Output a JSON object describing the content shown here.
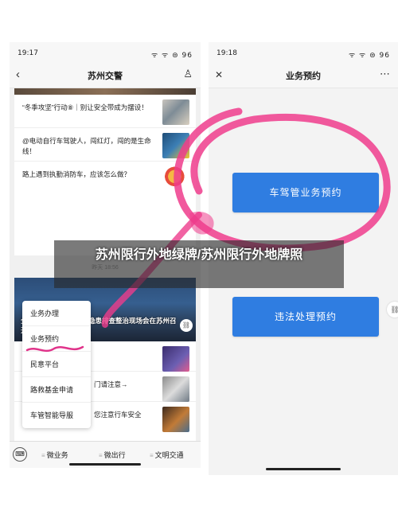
{
  "left_phone": {
    "status": {
      "time": "19:17",
      "icons": "ᯤ ᯤ ⊜ 96"
    },
    "navbar": {
      "title": "苏州交警",
      "back": "‹",
      "profile": "♙"
    },
    "news_top": [
      {
        "text": "“冬季攻坚”行动⑧｜别让安全带成为摆设！"
      },
      {
        "text": "@电动自行车驾驶人，闯红灯，闯的是生命线！"
      },
      {
        "text": "路上遇到执勤消防车，应该怎么做？"
      }
    ],
    "timestamp": "昨天 18:56",
    "banner_caption": "全国道路交通重大事故隐患排查整治现场会在苏州召开",
    "news_bottom": [
      {
        "text": ""
      },
      {
        "text": "门请注意→"
      },
      {
        "text": "您注意行车安全"
      }
    ],
    "popup_menu": [
      "业务办理",
      "业务预约",
      "民意平台",
      "路救基金申请",
      "车管智能导服"
    ],
    "bottom_bar": {
      "keyboard": "⌨",
      "tabs": [
        "微业务",
        "微出行",
        "文明交通"
      ]
    }
  },
  "right_phone": {
    "status": {
      "time": "19:18",
      "icons": "ᯤ ᯤ ⊜ 96"
    },
    "navbar": {
      "title": "业务预约",
      "close": "✕",
      "more": "⋯"
    },
    "buttons": {
      "driving": "车驾管业务预约",
      "violation": "违法处理预约"
    },
    "side_link": "🔗"
  },
  "overlay_title": "苏州限行外地绿牌/苏州限行外地牌照",
  "colors": {
    "button_blue": "#2f7de1",
    "highlight_pink": "#ee3c8c"
  }
}
